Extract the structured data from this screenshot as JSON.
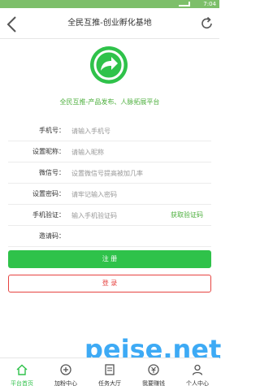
{
  "status": {
    "time": "7:04"
  },
  "header": {
    "title": "全民互推-创业孵化基地"
  },
  "brand": {
    "slogan": "全民互推-产品发布、人脉拓展平台",
    "accent": "#2fc24a",
    "danger": "#e64340"
  },
  "form": {
    "phone": {
      "label": "手机号：",
      "placeholder": "请输入手机号"
    },
    "nickname": {
      "label": "设置昵称：",
      "placeholder": "请输入昵称"
    },
    "wechat": {
      "label": "微信号：",
      "placeholder": "设置微信号提高被加几率"
    },
    "password": {
      "label": "设置密码：",
      "placeholder": "请牢记输入密码"
    },
    "verify": {
      "label": "手机验证：",
      "placeholder": "输入手机验证码",
      "get_code": "获取验证码"
    },
    "invite": {
      "label": "邀请码：",
      "placeholder": ""
    }
  },
  "buttons": {
    "register": "注  册",
    "login": "登  录"
  },
  "watermark": "peise.net",
  "tabs": [
    {
      "label": "平台首页",
      "icon": "home-icon",
      "active": true
    },
    {
      "label": "加粉中心",
      "icon": "add-fans-icon"
    },
    {
      "label": "任务大厅",
      "icon": "task-icon"
    },
    {
      "label": "我要赚钱",
      "icon": "money-icon"
    },
    {
      "label": "个人中心",
      "icon": "user-icon"
    }
  ]
}
